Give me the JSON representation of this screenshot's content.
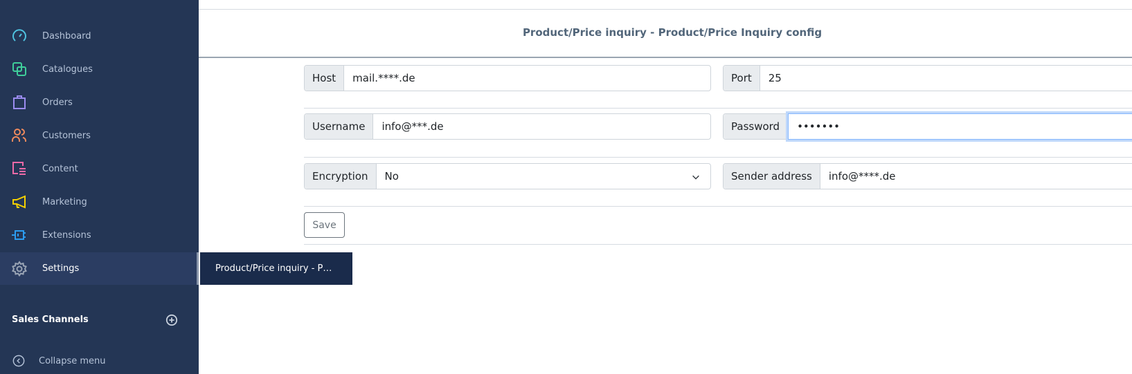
{
  "sidebar": {
    "items": [
      {
        "label": "Dashboard",
        "icon": "dashboard-icon",
        "color": "#4fc3e0"
      },
      {
        "label": "Catalogues",
        "icon": "catalogues-icon",
        "color": "#3fce9a"
      },
      {
        "label": "Orders",
        "icon": "orders-icon",
        "color": "#9b8cf0"
      },
      {
        "label": "Customers",
        "icon": "customers-icon",
        "color": "#f08a5d"
      },
      {
        "label": "Content",
        "icon": "content-icon",
        "color": "#f06aa8"
      },
      {
        "label": "Marketing",
        "icon": "marketing-icon",
        "color": "#f5d000"
      },
      {
        "label": "Extensions",
        "icon": "extensions-icon",
        "color": "#2c9cf0"
      },
      {
        "label": "Settings",
        "icon": "gear-icon",
        "color": "#9aa5b5",
        "active": true
      }
    ],
    "sales_channels": "Sales Channels",
    "collapse": "Collapse menu",
    "flyout": "Product/Price inquiry - P…"
  },
  "header": {
    "title": "Product/Price inquiry - Product/Price Inquiry config"
  },
  "form": {
    "host": {
      "label": "Host",
      "value": "mail.****.de"
    },
    "port": {
      "label": "Port",
      "value": "25"
    },
    "username": {
      "label": "Username",
      "value": "info@***.de"
    },
    "password": {
      "label": "Password",
      "value": "•••••••"
    },
    "encryption": {
      "label": "Encryption",
      "value": "No"
    },
    "sender": {
      "label": "Sender address",
      "value": "info@****.de"
    },
    "save": "Save"
  }
}
